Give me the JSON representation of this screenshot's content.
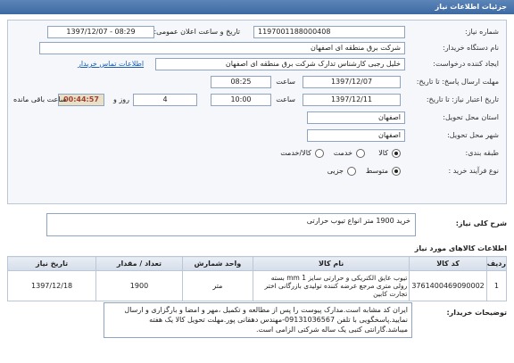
{
  "header": {
    "title": "جزئیات اطلاعات نیاز"
  },
  "form": {
    "need_number": {
      "label": "شماره نیاز:",
      "value": "1197001188000408"
    },
    "announce_datetime": {
      "label": "تاریخ و ساعت اعلان عمومی:",
      "value": "1397/12/07 - 08:29"
    },
    "buyer_org": {
      "label": "نام دستگاه خریدار:",
      "value": "شرکت برق منطقه ای اصفهان"
    },
    "requester": {
      "label": "ایجاد کننده درخواست:",
      "value": "خلیل رجبی کارشناس تدارک شرکت برق منطقه ای اصفهان",
      "contact_link": "اطلاعات تماس خریدار"
    },
    "reply_deadline": {
      "label": "مهلت ارسال پاسخ: تا تاریخ:",
      "date": "1397/12/07",
      "time_label": "ساعت",
      "time": "08:25"
    },
    "price_validity": {
      "label": "تاریخ اعتبار نیاز: تا تاریخ:",
      "date": "1397/12/11",
      "time_label": "ساعت",
      "time": "10:00",
      "days": "4",
      "days_label": "روز و",
      "remaining": "00:44:57",
      "remaining_label": "ساعت باقی مانده"
    },
    "delivery_province": {
      "label": "استان محل تحویل:",
      "value": "اصفهان"
    },
    "delivery_city": {
      "label": "شهر محل تحویل:",
      "value": "اصفهان"
    },
    "category": {
      "label": "طبقه بندی:",
      "options": [
        "کالا",
        "خدمت",
        "کالا/خدمت"
      ],
      "selected": 0
    },
    "purchase_type": {
      "label": "نوع فرآیند خرید :",
      "options": [
        "متوسط",
        "جزیی"
      ],
      "selected": 0
    }
  },
  "need_summary": {
    "label": "شرح کلی نیاز:",
    "value": "خرید 1900 متر انواع تیوب حرارتی"
  },
  "items_section": {
    "title": "اطلاعات کالاهای مورد نیاز"
  },
  "items_table": {
    "headers": [
      "ردیف",
      "کد کالا",
      "نام کالا",
      "واحد شمارش",
      "تعداد / مقدار",
      "تاریخ نیاز"
    ],
    "rows": [
      {
        "index": "1",
        "code": "3761400469090002",
        "name": "تیوب عایق الکتریکی و حرارتی سایز mm 1 بسته رولی متری مرجع عرضه کننده تولیدی بازرگانی اختر تجارت کابین",
        "unit": "متر",
        "qty": "1900",
        "date": "1397/12/18"
      }
    ]
  },
  "buyer_notes": {
    "label": "توضیحات خریدار:",
    "value": "ایران کد مشابه است.مدارک پیوست را پس از مطالعه و تکمیل ،مهر و امضا و بارگزاری و ارسال نمایید.پاسخگویی با تلفن 09131036567-مهندس دهقانی پور.مهلت تحویل کالا یک هفته میباشد.گارانتی کتبی یک ساله شرکتی الزامی است."
  }
}
